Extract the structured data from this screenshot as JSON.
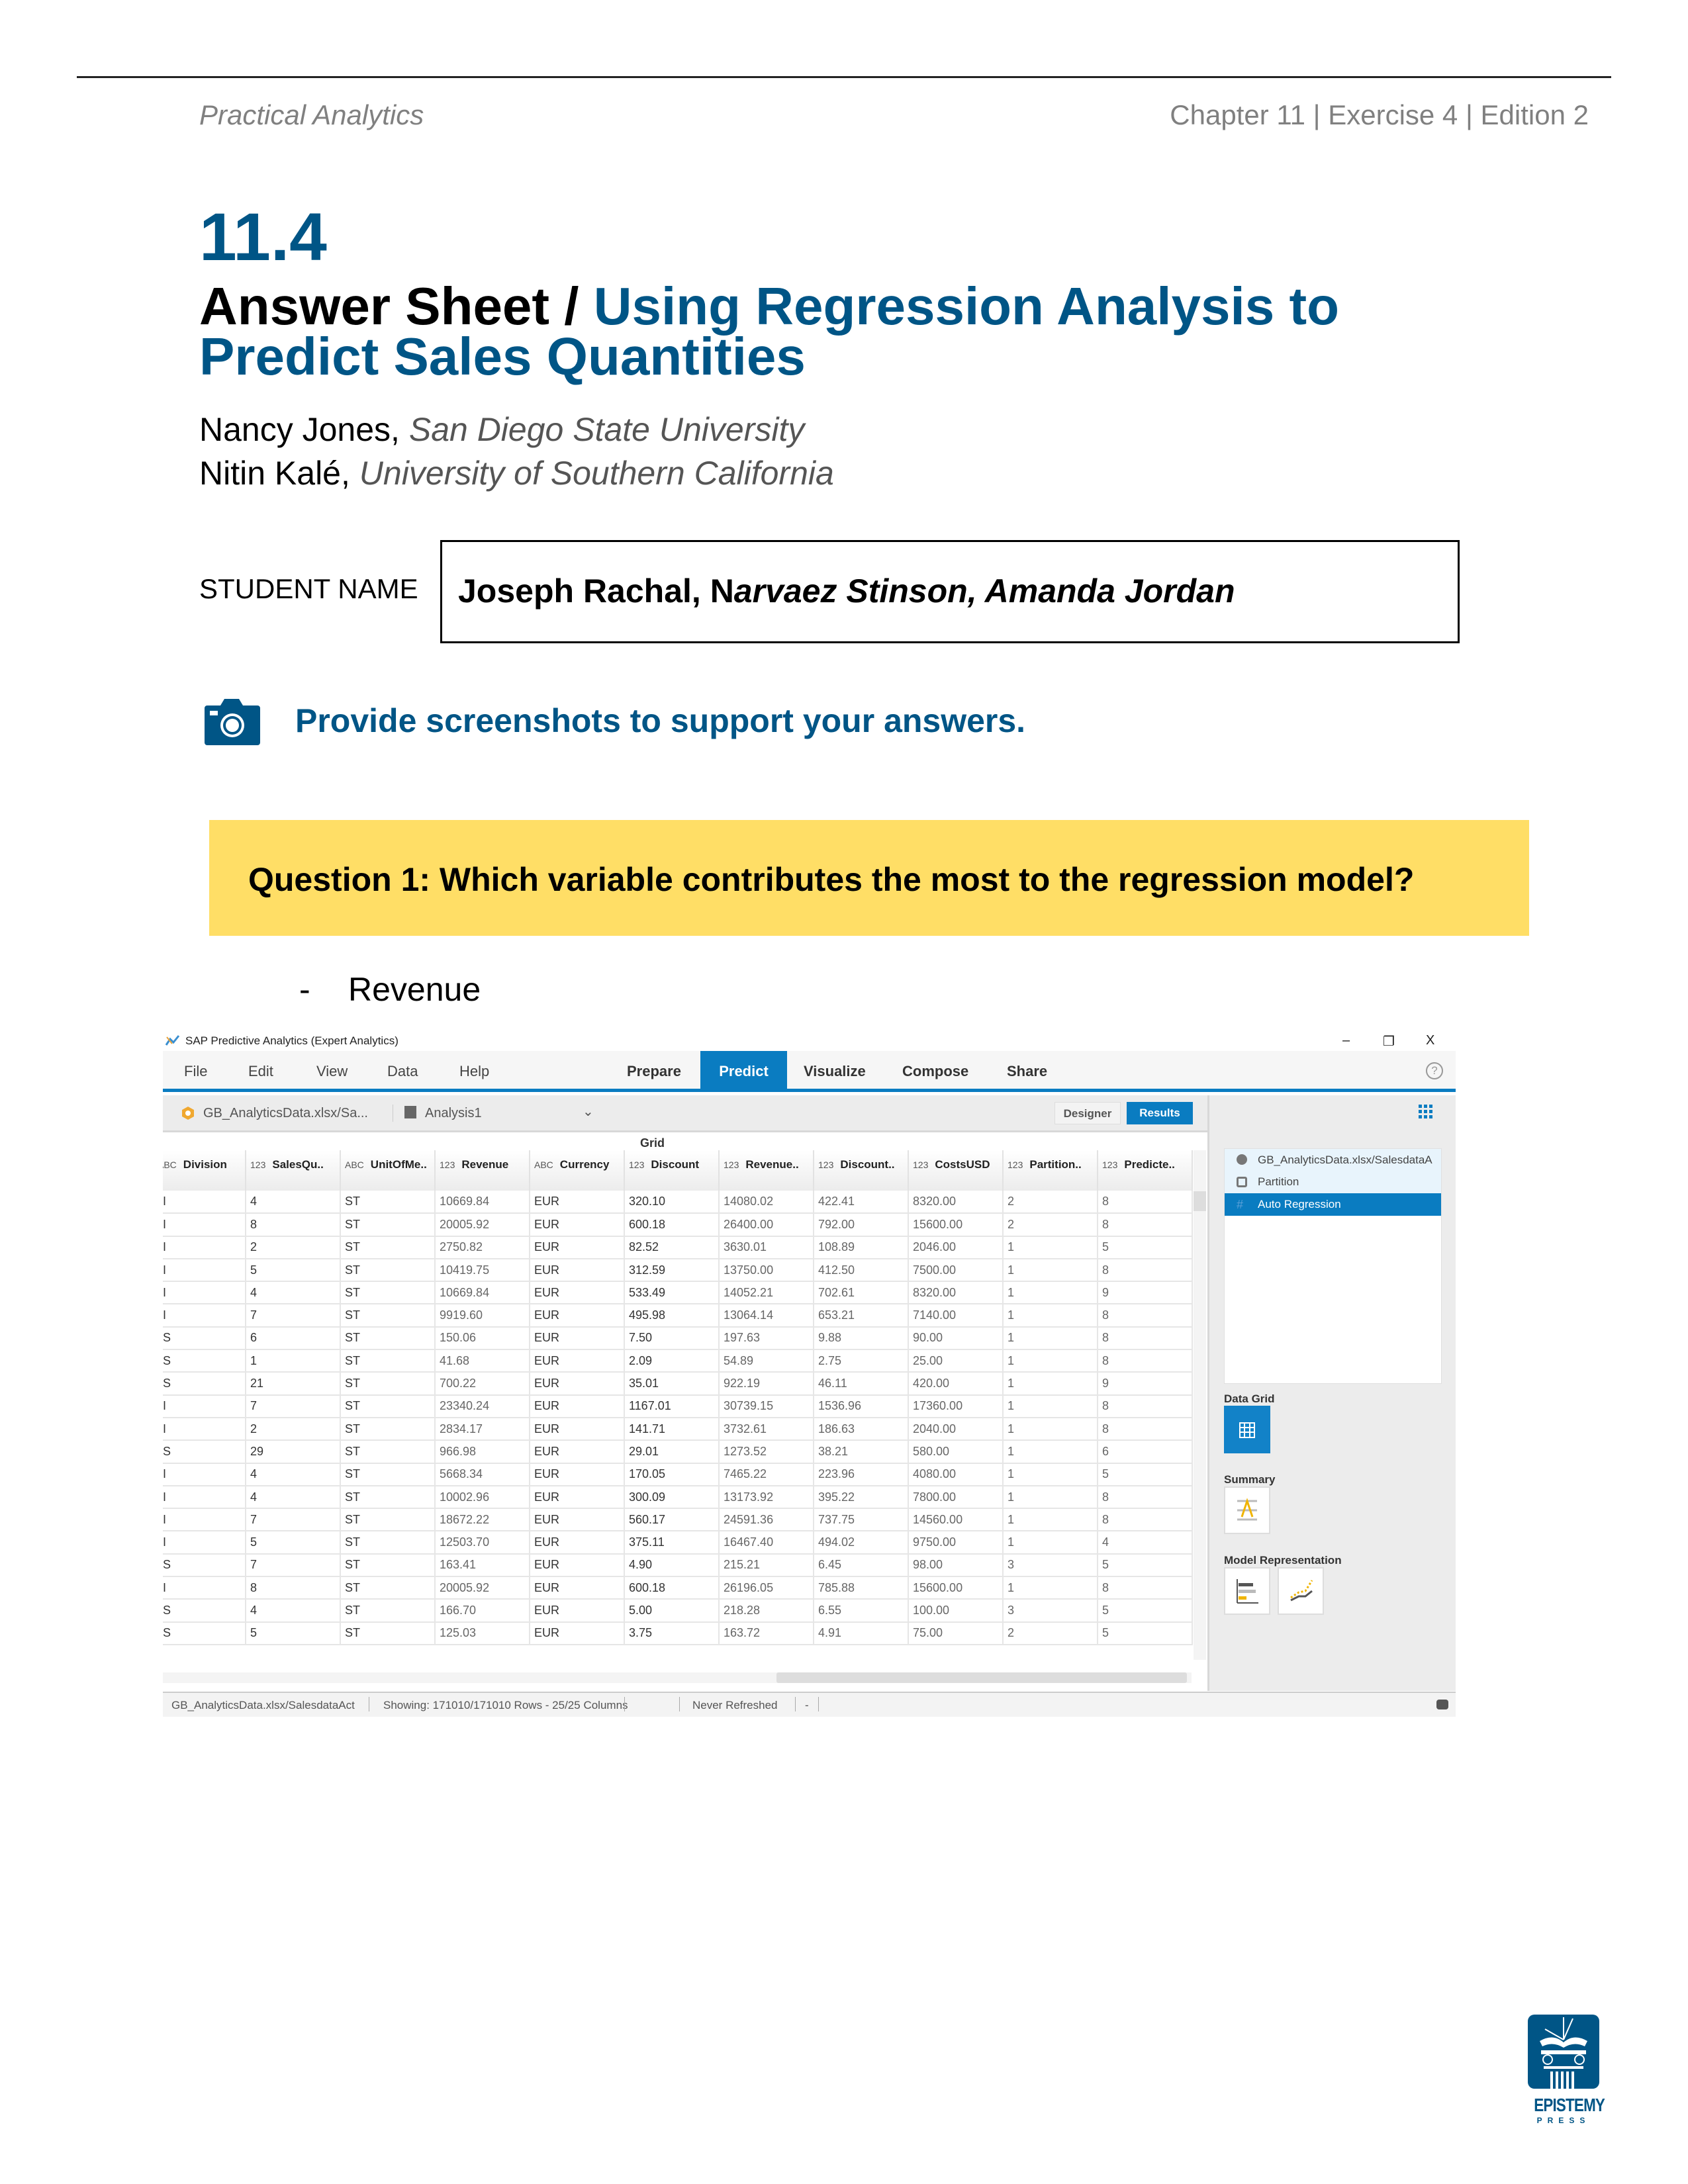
{
  "header": {
    "left": "Practical Analytics",
    "right": "Chapter 11 | Exercise 4 | Edition 2"
  },
  "section_number": "11.4",
  "title": {
    "black": "Answer Sheet / ",
    "blue_line1": "Using Regression Analysis to",
    "blue_line2": "Predict Sales Quantities"
  },
  "authors": [
    {
      "name": "Nancy Jones,",
      "affiliation": "San Diego State University"
    },
    {
      "name": "Nitin Kalé,",
      "affiliation": "University of Southern California"
    }
  ],
  "student": {
    "label": "STUDENT NAME",
    "value_upright": "Joseph Rachal, N",
    "value_italic": "arvaez Stinson, Amanda Jordan"
  },
  "instruction": "Provide screenshots to support your answers.",
  "question": "Question 1:  Which variable contributes the most to the regression model?",
  "answer": {
    "bullet": "-",
    "text": "Revenue"
  },
  "colors": {
    "brand_blue": "#005586",
    "question_bg": "#ffde66",
    "sap_blue": "#0a7cc1"
  },
  "app": {
    "title": "SAP Predictive Analytics (Expert Analytics)",
    "window_controls": {
      "minimize": "–",
      "restore": "❐",
      "close": "X"
    },
    "menu": [
      "File",
      "Edit",
      "View",
      "Data",
      "Help"
    ],
    "tabs": [
      "Prepare",
      "Predict",
      "Visualize",
      "Compose",
      "Share"
    ],
    "active_tab": "Predict",
    "help": "?",
    "toolbar": {
      "dataset": "GB_AnalyticsData.xlsx/Sa...",
      "analysis": "Analysis1",
      "chevron": "⌄",
      "designer": "Designer",
      "results": "Results"
    },
    "grid_title": "Grid",
    "columns": [
      {
        "type": "ABC",
        "name": "Division"
      },
      {
        "type": "123",
        "name": "SalesQu.."
      },
      {
        "type": "ABC",
        "name": "UnitOfMe.."
      },
      {
        "type": "123",
        "name": "Revenue"
      },
      {
        "type": "ABC",
        "name": "Currency"
      },
      {
        "type": "123",
        "name": "Discount"
      },
      {
        "type": "123",
        "name": "Revenue.."
      },
      {
        "type": "123",
        "name": "Discount.."
      },
      {
        "type": "123",
        "name": "CostsUSD"
      },
      {
        "type": "123",
        "name": "Partition.."
      },
      {
        "type": "123",
        "name": "Predicte.."
      }
    ],
    "rows": [
      [
        "I",
        "4",
        "ST",
        "10669.84",
        "EUR",
        "320.10",
        "14080.02",
        "422.41",
        "8320.00",
        "2",
        "8"
      ],
      [
        "I",
        "8",
        "ST",
        "20005.92",
        "EUR",
        "600.18",
        "26400.00",
        "792.00",
        "15600.00",
        "2",
        "8"
      ],
      [
        "I",
        "2",
        "ST",
        "2750.82",
        "EUR",
        "82.52",
        "3630.01",
        "108.89",
        "2046.00",
        "1",
        "5"
      ],
      [
        "I",
        "5",
        "ST",
        "10419.75",
        "EUR",
        "312.59",
        "13750.00",
        "412.50",
        "7500.00",
        "1",
        "8"
      ],
      [
        "I",
        "4",
        "ST",
        "10669.84",
        "EUR",
        "533.49",
        "14052.21",
        "702.61",
        "8320.00",
        "1",
        "9"
      ],
      [
        "I",
        "7",
        "ST",
        "9919.60",
        "EUR",
        "495.98",
        "13064.14",
        "653.21",
        "7140.00",
        "1",
        "8"
      ],
      [
        "S",
        "6",
        "ST",
        "150.06",
        "EUR",
        "7.50",
        "197.63",
        "9.88",
        "90.00",
        "1",
        "8"
      ],
      [
        "S",
        "1",
        "ST",
        "41.68",
        "EUR",
        "2.09",
        "54.89",
        "2.75",
        "25.00",
        "1",
        "8"
      ],
      [
        "S",
        "21",
        "ST",
        "700.22",
        "EUR",
        "35.01",
        "922.19",
        "46.11",
        "420.00",
        "1",
        "9"
      ],
      [
        "I",
        "7",
        "ST",
        "23340.24",
        "EUR",
        "1167.01",
        "30739.15",
        "1536.96",
        "17360.00",
        "1",
        "8"
      ],
      [
        "I",
        "2",
        "ST",
        "2834.17",
        "EUR",
        "141.71",
        "3732.61",
        "186.63",
        "2040.00",
        "1",
        "8"
      ],
      [
        "S",
        "29",
        "ST",
        "966.98",
        "EUR",
        "29.01",
        "1273.52",
        "38.21",
        "580.00",
        "1",
        "6"
      ],
      [
        "I",
        "4",
        "ST",
        "5668.34",
        "EUR",
        "170.05",
        "7465.22",
        "223.96",
        "4080.00",
        "1",
        "5"
      ],
      [
        "I",
        "4",
        "ST",
        "10002.96",
        "EUR",
        "300.09",
        "13173.92",
        "395.22",
        "7800.00",
        "1",
        "8"
      ],
      [
        "I",
        "7",
        "ST",
        "18672.22",
        "EUR",
        "560.17",
        "24591.36",
        "737.75",
        "14560.00",
        "1",
        "8"
      ],
      [
        "I",
        "5",
        "ST",
        "12503.70",
        "EUR",
        "375.11",
        "16467.40",
        "494.02",
        "9750.00",
        "1",
        "4"
      ],
      [
        "S",
        "7",
        "ST",
        "163.41",
        "EUR",
        "4.90",
        "215.21",
        "6.45",
        "98.00",
        "3",
        "5"
      ],
      [
        "I",
        "8",
        "ST",
        "20005.92",
        "EUR",
        "600.18",
        "26196.05",
        "785.88",
        "15600.00",
        "1",
        "8"
      ],
      [
        "S",
        "4",
        "ST",
        "166.70",
        "EUR",
        "5.00",
        "218.28",
        "6.55",
        "100.00",
        "3",
        "5"
      ],
      [
        "S",
        "5",
        "ST",
        "125.03",
        "EUR",
        "3.75",
        "163.72",
        "4.91",
        "75.00",
        "2",
        "5"
      ]
    ],
    "flow": [
      "GB_AnalyticsData.xlsx/SalesdataA",
      "Partition",
      "Auto Regression"
    ],
    "panel": {
      "data_grid": "Data Grid",
      "summary": "Summary",
      "model_representation": "Model Representation"
    },
    "status": {
      "source": "GB_AnalyticsData.xlsx/SalesdataAct",
      "showing": "Showing: 171010/171010 Rows - 25/25 Columns",
      "refresh": "Never Refreshed",
      "dash": "-"
    }
  },
  "logo": {
    "line1": "EPISTEMY",
    "line2": "PRESS"
  }
}
